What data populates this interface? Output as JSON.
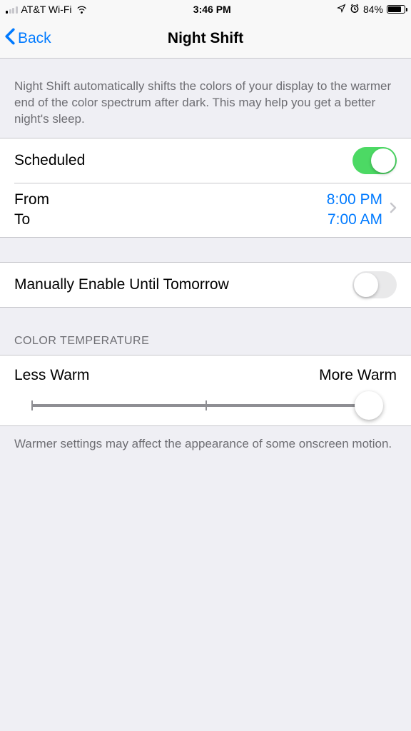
{
  "status_bar": {
    "carrier": "AT&T Wi-Fi",
    "time": "3:46 PM",
    "battery_percent": "84%",
    "icons": {
      "location": "location-arrow",
      "alarm": "alarm-clock"
    }
  },
  "nav": {
    "back_label": "Back",
    "title": "Night Shift"
  },
  "description": "Night Shift automatically shifts the colors of your display to the warmer end of the color spectrum after dark. This may help you get a better night's sleep.",
  "scheduled": {
    "label": "Scheduled",
    "enabled": true,
    "from_label": "From",
    "to_label": "To",
    "from_time": "8:00 PM",
    "to_time": "7:00 AM"
  },
  "manual": {
    "label": "Manually Enable Until Tomorrow",
    "enabled": false
  },
  "color_temperature": {
    "header": "COLOR TEMPERATURE",
    "less_label": "Less Warm",
    "more_label": "More Warm",
    "value_percent": 97
  },
  "footer_note": "Warmer settings may affect the appearance of some onscreen motion."
}
